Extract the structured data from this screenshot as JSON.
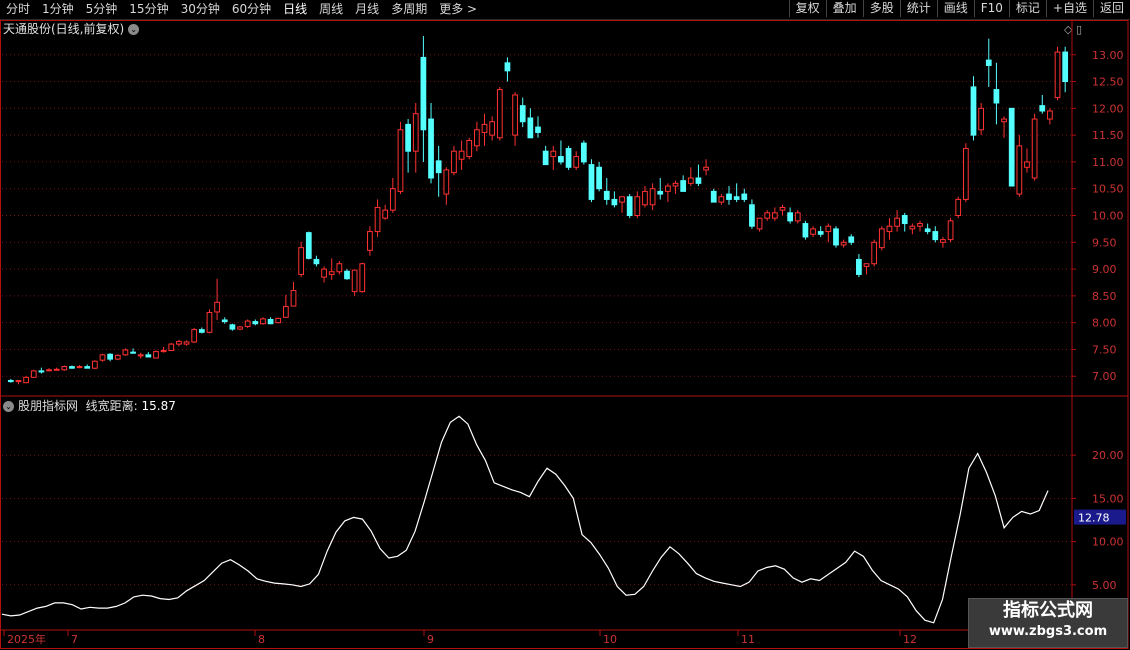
{
  "toolbar": {
    "left": [
      {
        "label": "分时",
        "active": false
      },
      {
        "label": "1分钟",
        "active": false
      },
      {
        "label": "5分钟",
        "active": false
      },
      {
        "label": "15分钟",
        "active": false
      },
      {
        "label": "30分钟",
        "active": false
      },
      {
        "label": "60分钟",
        "active": false
      },
      {
        "label": "日线",
        "active": true
      },
      {
        "label": "周线",
        "active": false
      },
      {
        "label": "月线",
        "active": false
      },
      {
        "label": "多周期",
        "active": false
      },
      {
        "label": "更多 >",
        "active": false
      }
    ],
    "right": [
      "复权",
      "叠加",
      "多股",
      "统计",
      "画线",
      "F10",
      "标记",
      "+自选",
      "返回"
    ]
  },
  "main_panel": {
    "title": "天通股份(日线,前复权)",
    "top_icons": "◇ ▯"
  },
  "indicator_panel": {
    "name": "股朋指标网",
    "field": "线宽距离:",
    "value": "15.87",
    "cursor_value": "12.78"
  },
  "watermark": {
    "line1": "指标公式网",
    "line2": "www.zbgs3.com"
  },
  "colors": {
    "up": "#ff3232",
    "down": "#54ffff",
    "line": "#ffffff",
    "axis": "#b01010",
    "grid": "#7a1010",
    "price_label": "#cc3333",
    "badge_bg": "#1a1a8c"
  },
  "x_axis": {
    "labels": [
      "2025年",
      "7",
      "8",
      "9",
      "10",
      "11",
      "12"
    ]
  },
  "chart_data": [
    {
      "type": "candlestick",
      "title": "天通股份(日线,前复权)",
      "ylim": [
        6.65,
        13.35
      ],
      "yticks": [
        7.0,
        7.5,
        8.0,
        8.5,
        9.0,
        9.5,
        10.0,
        10.5,
        11.0,
        11.5,
        12.0,
        12.5,
        13.0
      ],
      "candles": [
        [
          6.92,
          6.95,
          6.88,
          6.9
        ],
        [
          6.9,
          6.93,
          6.85,
          6.92
        ],
        [
          6.88,
          7.0,
          6.87,
          6.98
        ],
        [
          6.98,
          7.12,
          6.97,
          7.1
        ],
        [
          7.1,
          7.16,
          7.05,
          7.08
        ],
        [
          7.12,
          7.15,
          7.1,
          7.12
        ],
        [
          7.13,
          7.16,
          7.11,
          7.13
        ],
        [
          7.12,
          7.2,
          7.1,
          7.18
        ],
        [
          7.18,
          7.2,
          7.14,
          7.15
        ],
        [
          7.17,
          7.21,
          7.15,
          7.18
        ],
        [
          7.18,
          7.22,
          7.15,
          7.15
        ],
        [
          7.15,
          7.3,
          7.13,
          7.28
        ],
        [
          7.3,
          7.42,
          7.27,
          7.4
        ],
        [
          7.41,
          7.43,
          7.28,
          7.32
        ],
        [
          7.32,
          7.41,
          7.3,
          7.39
        ],
        [
          7.4,
          7.52,
          7.38,
          7.49
        ],
        [
          7.45,
          7.52,
          7.42,
          7.43
        ],
        [
          7.38,
          7.44,
          7.33,
          7.4
        ],
        [
          7.4,
          7.45,
          7.35,
          7.36
        ],
        [
          7.34,
          7.48,
          7.33,
          7.46
        ],
        [
          7.46,
          7.55,
          7.44,
          7.48
        ],
        [
          7.48,
          7.62,
          7.47,
          7.6
        ],
        [
          7.6,
          7.68,
          7.56,
          7.65
        ],
        [
          7.6,
          7.67,
          7.57,
          7.64
        ],
        [
          7.64,
          7.9,
          7.62,
          7.87
        ],
        [
          7.87,
          7.91,
          7.8,
          7.82
        ],
        [
          7.82,
          8.25,
          7.8,
          8.19
        ],
        [
          8.2,
          8.82,
          8.05,
          8.38
        ],
        [
          8.05,
          8.1,
          7.98,
          8.02
        ],
        [
          7.96,
          7.98,
          7.85,
          7.88
        ],
        [
          7.88,
          7.94,
          7.86,
          7.92
        ],
        [
          7.93,
          8.06,
          7.9,
          8.03
        ],
        [
          8.02,
          8.06,
          7.95,
          7.98
        ],
        [
          7.98,
          8.1,
          7.96,
          8.07
        ],
        [
          8.06,
          8.1,
          7.97,
          7.98
        ],
        [
          8.0,
          8.09,
          7.99,
          8.08
        ],
        [
          8.1,
          8.52,
          8.09,
          8.3
        ],
        [
          8.31,
          8.76,
          8.3,
          8.6
        ],
        [
          8.9,
          9.51,
          8.85,
          9.4
        ],
        [
          9.68,
          9.7,
          9.18,
          9.2
        ],
        [
          9.18,
          9.25,
          9.05,
          9.1
        ],
        [
          8.85,
          9.05,
          8.75,
          9.0
        ],
        [
          8.9,
          9.2,
          8.8,
          8.95
        ],
        [
          8.95,
          9.15,
          8.9,
          9.1
        ],
        [
          8.96,
          9.0,
          8.8,
          8.82
        ],
        [
          8.58,
          8.6,
          8.5,
          8.98
        ],
        [
          8.58,
          9.12,
          8.56,
          9.1
        ],
        [
          9.35,
          9.8,
          9.25,
          9.7
        ],
        [
          9.7,
          10.3,
          9.6,
          10.15
        ],
        [
          9.95,
          10.2,
          9.92,
          10.1
        ],
        [
          10.1,
          10.7,
          10.05,
          10.5
        ],
        [
          10.45,
          11.75,
          10.4,
          11.6
        ],
        [
          11.7,
          11.8,
          10.8,
          11.2
        ],
        [
          11.2,
          12.1,
          10.8,
          11.9
        ],
        [
          12.95,
          13.35,
          11.0,
          11.6
        ],
        [
          11.8,
          12.1,
          10.6,
          10.7
        ],
        [
          11.02,
          11.3,
          10.35,
          10.8
        ],
        [
          10.4,
          10.9,
          10.2,
          10.85
        ],
        [
          10.8,
          11.3,
          10.75,
          11.2
        ],
        [
          11.05,
          11.4,
          10.85,
          11.2
        ],
        [
          11.1,
          11.45,
          11.05,
          11.4
        ],
        [
          11.3,
          11.75,
          11.2,
          11.6
        ],
        [
          11.55,
          11.9,
          11.3,
          11.7
        ],
        [
          11.5,
          11.85,
          11.4,
          11.75
        ],
        [
          11.45,
          12.4,
          11.4,
          12.35
        ],
        [
          12.85,
          12.95,
          12.5,
          12.7
        ],
        [
          11.5,
          12.3,
          11.3,
          12.25
        ],
        [
          12.05,
          12.2,
          11.65,
          11.75
        ],
        [
          11.82,
          12.0,
          11.45,
          11.45
        ],
        [
          11.65,
          11.85,
          11.45,
          11.55
        ],
        [
          11.2,
          11.3,
          10.95,
          10.95
        ],
        [
          11.1,
          11.3,
          10.85,
          11.2
        ],
        [
          11.1,
          11.4,
          10.95,
          11.0
        ],
        [
          11.25,
          11.3,
          10.85,
          10.9
        ],
        [
          10.9,
          11.2,
          10.85,
          11.1
        ],
        [
          11.35,
          11.4,
          10.95,
          11.0
        ],
        [
          10.95,
          11.05,
          10.25,
          10.3
        ],
        [
          10.9,
          11.0,
          10.45,
          10.5
        ],
        [
          10.45,
          10.7,
          10.2,
          10.3
        ],
        [
          10.3,
          10.45,
          10.15,
          10.2
        ],
        [
          10.25,
          10.35,
          10.05,
          10.35
        ],
        [
          10.35,
          10.4,
          9.95,
          10.0
        ],
        [
          10.0,
          10.45,
          9.95,
          10.35
        ],
        [
          10.2,
          10.55,
          10.15,
          10.45
        ],
        [
          10.2,
          10.6,
          10.1,
          10.5
        ],
        [
          10.45,
          10.7,
          10.3,
          10.4
        ],
        [
          10.45,
          10.6,
          10.25,
          10.55
        ],
        [
          10.55,
          10.65,
          10.4,
          10.6
        ],
        [
          10.65,
          10.75,
          10.45,
          10.45
        ],
        [
          10.6,
          10.9,
          10.55,
          10.7
        ],
        [
          10.7,
          10.95,
          10.55,
          10.6
        ],
        [
          10.85,
          11.05,
          10.75,
          10.9
        ],
        [
          10.45,
          10.5,
          10.25,
          10.25
        ],
        [
          10.25,
          10.4,
          10.2,
          10.35
        ],
        [
          10.4,
          10.55,
          10.2,
          10.3
        ],
        [
          10.35,
          10.6,
          10.25,
          10.3
        ],
        [
          10.4,
          10.5,
          10.25,
          10.3
        ],
        [
          10.2,
          10.3,
          9.75,
          9.8
        ],
        [
          9.75,
          9.95,
          9.7,
          9.95
        ],
        [
          9.95,
          10.1,
          9.9,
          10.05
        ],
        [
          9.95,
          10.15,
          9.9,
          10.05
        ],
        [
          10.1,
          10.2,
          10.0,
          10.15
        ],
        [
          10.05,
          10.15,
          9.85,
          9.9
        ],
        [
          9.9,
          10.1,
          9.85,
          10.05
        ],
        [
          9.85,
          9.9,
          9.55,
          9.6
        ],
        [
          9.65,
          9.8,
          9.6,
          9.75
        ],
        [
          9.7,
          9.8,
          9.6,
          9.65
        ],
        [
          9.7,
          9.85,
          9.5,
          9.8
        ],
        [
          9.75,
          9.8,
          9.4,
          9.45
        ],
        [
          9.45,
          9.55,
          9.4,
          9.5
        ],
        [
          9.6,
          9.65,
          9.45,
          9.5
        ],
        [
          9.18,
          9.28,
          8.85,
          8.9
        ],
        [
          9.05,
          9.1,
          8.9,
          9.1
        ],
        [
          9.1,
          9.55,
          9.05,
          9.5
        ],
        [
          9.4,
          9.8,
          9.35,
          9.75
        ],
        [
          9.7,
          9.95,
          9.55,
          9.8
        ],
        [
          9.8,
          10.1,
          9.7,
          9.95
        ],
        [
          10.0,
          10.05,
          9.7,
          9.85
        ],
        [
          9.75,
          9.85,
          9.65,
          9.8
        ],
        [
          9.8,
          9.9,
          9.7,
          9.85
        ],
        [
          9.75,
          9.85,
          9.65,
          9.7
        ],
        [
          9.7,
          9.8,
          9.5,
          9.55
        ],
        [
          9.5,
          9.6,
          9.4,
          9.55
        ],
        [
          9.55,
          9.95,
          9.5,
          9.9
        ],
        [
          10.0,
          10.35,
          9.95,
          10.3
        ],
        [
          10.3,
          11.35,
          10.25,
          11.25
        ],
        [
          12.4,
          12.6,
          11.4,
          11.5
        ],
        [
          11.6,
          12.1,
          11.5,
          12.0
        ],
        [
          12.9,
          13.3,
          12.4,
          12.8
        ],
        [
          12.35,
          12.85,
          11.7,
          12.1
        ],
        [
          11.75,
          11.85,
          11.45,
          11.8
        ],
        [
          12.0,
          12.0,
          10.6,
          10.55
        ],
        [
          10.4,
          11.5,
          10.35,
          11.3
        ],
        [
          10.9,
          11.25,
          10.8,
          11.0
        ],
        [
          10.7,
          11.9,
          10.65,
          11.8
        ],
        [
          12.05,
          12.25,
          11.9,
          11.95
        ],
        [
          11.8,
          12.0,
          11.7,
          11.95
        ],
        [
          12.2,
          13.15,
          12.15,
          13.05
        ],
        [
          13.05,
          13.15,
          12.3,
          12.5
        ]
      ]
    },
    {
      "type": "line",
      "series": [
        {
          "name": "线宽距离",
          "values": [
            1.6,
            1.4,
            1.5,
            1.9,
            2.3,
            2.5,
            2.9,
            2.9,
            2.7,
            2.2,
            2.4,
            2.3,
            2.3,
            2.5,
            2.9,
            3.6,
            3.8,
            3.7,
            3.4,
            3.3,
            3.5,
            4.3,
            4.9,
            5.5,
            6.5,
            7.5,
            7.9,
            7.3,
            6.6,
            5.7,
            5.4,
            5.2,
            5.1,
            5.0,
            4.8,
            5.1,
            6.2,
            8.9,
            11.1,
            12.4,
            12.8,
            12.6,
            11.2,
            9.2,
            8.1,
            8.3,
            9.0,
            11.2,
            14.5,
            18.0,
            21.5,
            23.8,
            24.5,
            23.6,
            21.2,
            19.4,
            16.8,
            16.4,
            16.0,
            15.7,
            15.2,
            17.0,
            18.5,
            17.8,
            16.5,
            15.0,
            10.8,
            9.9,
            8.5,
            6.9,
            4.8,
            3.8,
            3.9,
            4.8,
            6.6,
            8.2,
            9.4,
            8.6,
            7.5,
            6.3,
            5.8,
            5.4,
            5.2,
            5.0,
            4.8,
            5.3,
            6.6,
            7.0,
            7.2,
            6.8,
            5.8,
            5.3,
            5.7,
            5.5,
            6.2,
            6.9,
            7.6,
            8.9,
            8.3,
            6.7,
            5.5,
            5.0,
            4.5,
            3.6,
            2.0,
            0.9,
            0.6,
            3.3,
            8.3,
            13.1,
            18.5,
            20.2,
            18.0,
            15.3,
            11.6,
            12.8,
            13.5,
            13.2,
            13.6,
            15.9
          ]
        }
      ],
      "ylim": [
        0,
        25
      ],
      "yticks": [
        5.0,
        10.0,
        15.0,
        20.0
      ]
    }
  ]
}
